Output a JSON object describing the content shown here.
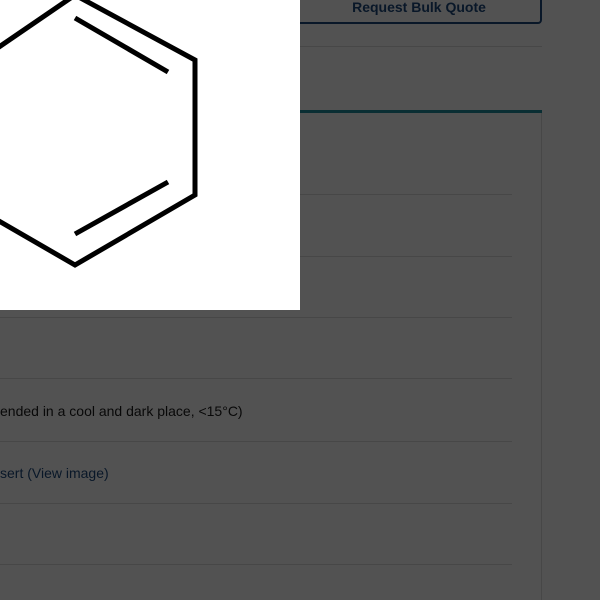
{
  "actions": {
    "bulk_quote_label": "Request Bulk Quote"
  },
  "specs": {
    "storage_value": "ended in a cool and dark place, <15°C)",
    "insert_link": "sert (View image)"
  },
  "lightbox": {
    "image_icon": "benzene-ring-structure"
  },
  "colors": {
    "brand": "#1c4a7e",
    "tab_accent": "#1f8ea0",
    "overlay": "rgba(0,0,0,0.68)"
  }
}
